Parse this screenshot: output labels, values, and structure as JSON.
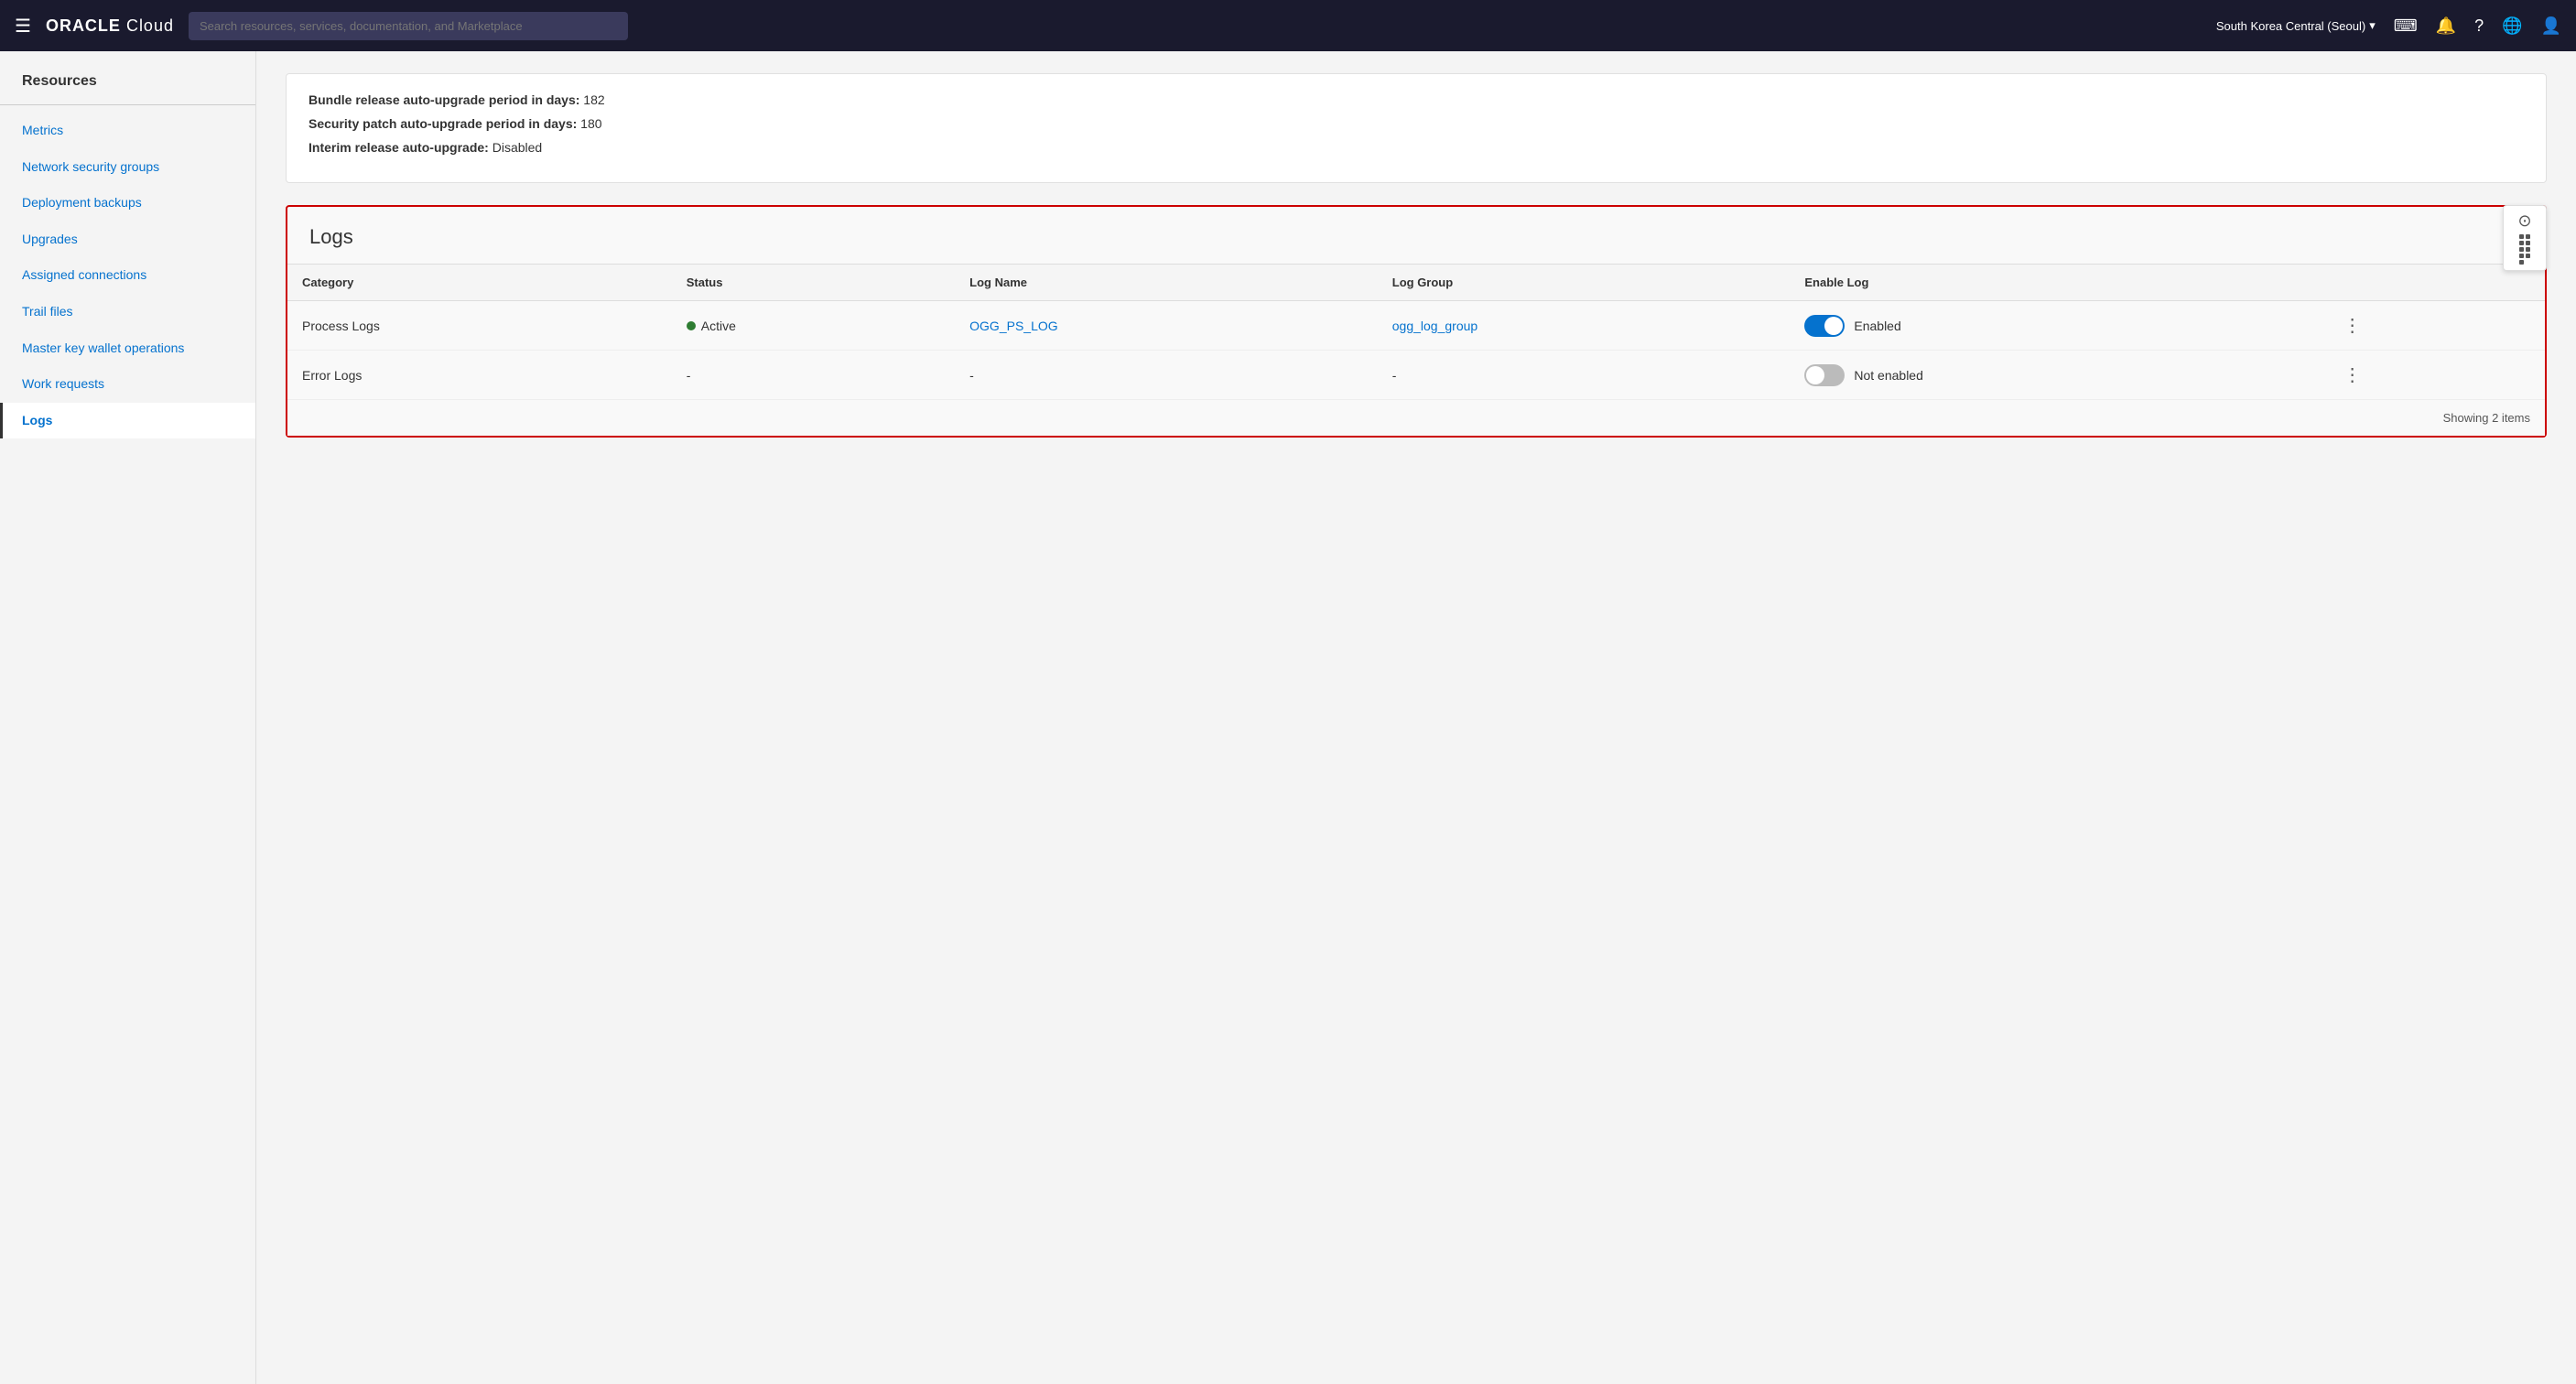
{
  "nav": {
    "hamburger": "☰",
    "logo_oracle": "ORACLE",
    "logo_cloud": " Cloud",
    "search_placeholder": "Search resources, services, documentation, and Marketplace",
    "region": "South Korea Central (Seoul)",
    "chevron": "▾"
  },
  "sidebar": {
    "resources_title": "Resources",
    "items": [
      {
        "id": "metrics",
        "label": "Metrics",
        "active": false
      },
      {
        "id": "network-security-groups",
        "label": "Network security groups",
        "active": false
      },
      {
        "id": "deployment-backups",
        "label": "Deployment backups",
        "active": false
      },
      {
        "id": "upgrades",
        "label": "Upgrades",
        "active": false
      },
      {
        "id": "assigned-connections",
        "label": "Assigned connections",
        "active": false
      },
      {
        "id": "trail-files",
        "label": "Trail files",
        "active": false
      },
      {
        "id": "master-key-wallet-operations",
        "label": "Master key wallet operations",
        "active": false
      },
      {
        "id": "work-requests",
        "label": "Work requests",
        "active": false
      },
      {
        "id": "logs",
        "label": "Logs",
        "active": true
      }
    ]
  },
  "info_section": {
    "bundle_label": "Bundle release auto-upgrade period in days:",
    "bundle_value": "182",
    "security_label": "Security patch auto-upgrade period in days:",
    "security_value": "180",
    "interim_label": "Interim release auto-upgrade:",
    "interim_value": "Disabled"
  },
  "logs": {
    "title": "Logs",
    "table": {
      "headers": [
        "Category",
        "Status",
        "Log Name",
        "Log Group",
        "Enable Log"
      ],
      "rows": [
        {
          "category": "Process Logs",
          "status": "Active",
          "status_type": "active",
          "log_name": "OGG_PS_LOG",
          "log_group": "ogg_log_group",
          "enabled": true,
          "enable_label": "Enabled"
        },
        {
          "category": "Error Logs",
          "status": "-",
          "status_type": "none",
          "log_name": "-",
          "log_group": "-",
          "enabled": false,
          "enable_label": "Not enabled"
        }
      ]
    },
    "footer": "Showing 2 items"
  }
}
